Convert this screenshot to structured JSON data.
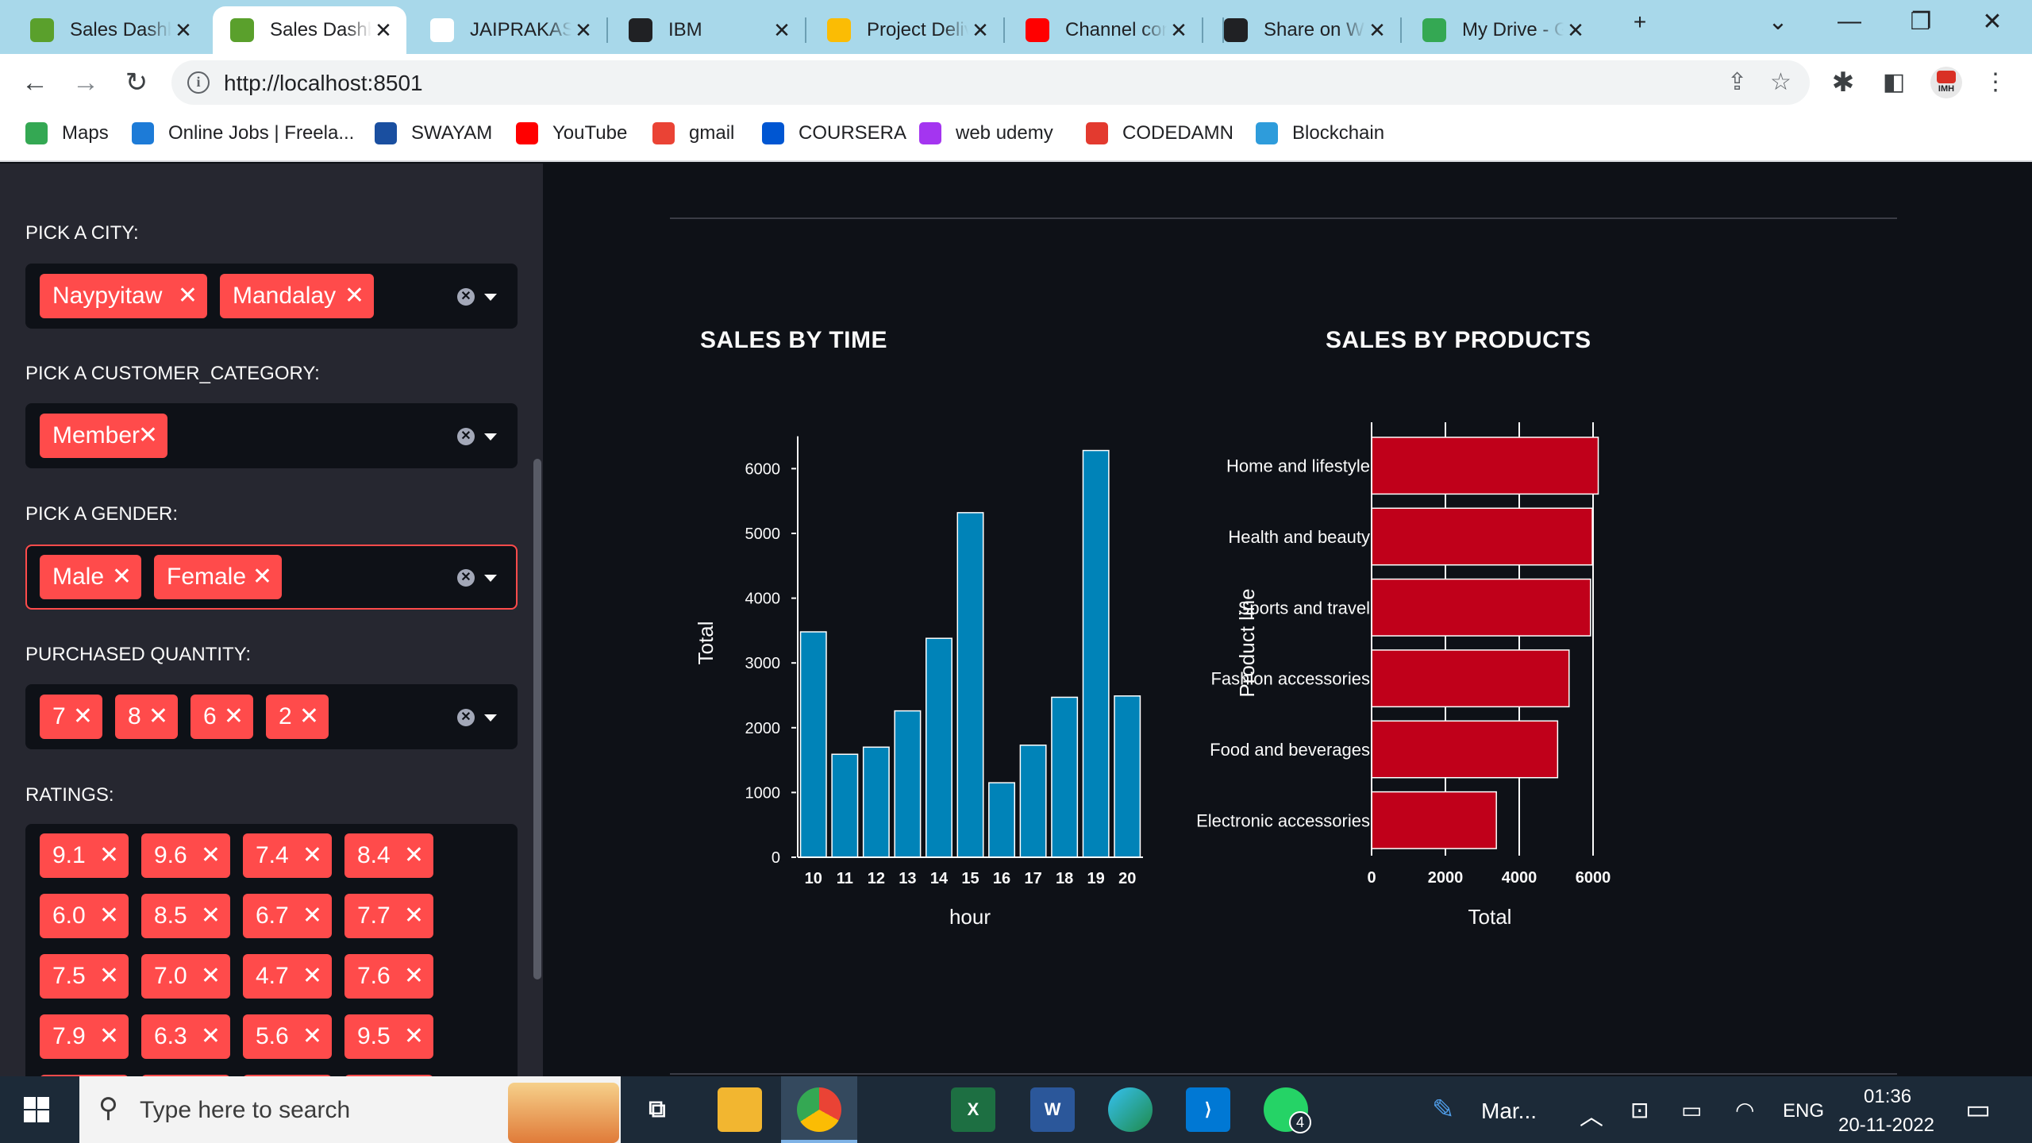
{
  "browser": {
    "tabs": [
      {
        "title": "Sales Dashboard",
        "icon_color": "#5aa02c",
        "active": false
      },
      {
        "title": "Sales Dashboard",
        "icon_color": "#5aa02c",
        "active": true
      },
      {
        "title": "JAIPRAKASH",
        "icon_color": "#ffffff",
        "active": false
      },
      {
        "title": "IBM",
        "icon_color": "#202124",
        "active": false
      },
      {
        "title": "Project Delivery",
        "icon_color": "#fbbc04",
        "active": false
      },
      {
        "title": "Channel content",
        "icon_color": "#ff0000",
        "active": false
      },
      {
        "title": "Share on WhatsApp",
        "icon_color": "#202124",
        "active": false
      },
      {
        "title": "My Drive - Google Drive",
        "icon_color": "#34a853",
        "active": false
      }
    ],
    "new_tab_label": "+",
    "url": "http://localhost:8501",
    "bookmarks": [
      {
        "label": "Maps",
        "icon_color": "#34a853"
      },
      {
        "label": "Online Jobs | Freela...",
        "icon_color": "#1d7bd7"
      },
      {
        "label": "SWAYAM",
        "icon_color": "#1a4fa0"
      },
      {
        "label": "YouTube",
        "icon_color": "#ff0000"
      },
      {
        "label": "gmail",
        "icon_color": "#ea4335"
      },
      {
        "label": "COURSERA",
        "icon_color": "#0056d2"
      },
      {
        "label": "web udemy",
        "icon_color": "#a435f0"
      },
      {
        "label": "CODEDAMN",
        "icon_color": "#e33a2f"
      },
      {
        "label": "Blockchain",
        "icon_color": "#2e9cdb"
      }
    ],
    "profile_label": "IMH"
  },
  "sidebar": {
    "city": {
      "label": "PICK A CITY:",
      "chips": [
        "Naypyitaw",
        "Mandalay"
      ]
    },
    "customer": {
      "label": "PICK A CUSTOMER_CATEGORY:",
      "chips": [
        "Member"
      ]
    },
    "gender": {
      "label": "PICK A GENDER:",
      "chips": [
        "Male",
        "Female"
      ]
    },
    "quantity": {
      "label": "PURCHASED QUANTITY:",
      "chips": [
        "7",
        "8",
        "6",
        "2"
      ]
    },
    "ratings": {
      "label": "RATINGS:",
      "chips": [
        "9.1",
        "9.6",
        "7.4",
        "8.4",
        "6.0",
        "8.5",
        "6.7",
        "7.7",
        "7.5",
        "7.0",
        "4.7",
        "7.6",
        "7.9",
        "6.3",
        "5.6",
        "9.5"
      ]
    },
    "chip_close": "✕",
    "clear_glyph": "✕"
  },
  "main": {
    "time_title": "SALES BY TIME",
    "products_title": "SALES BY PRODUCTS"
  },
  "chart_data": [
    {
      "type": "bar",
      "title": "SALES BY TIME",
      "xlabel": "hour",
      "ylabel": "Total",
      "categories": [
        "10",
        "11",
        "12",
        "13",
        "14",
        "15",
        "16",
        "17",
        "18",
        "19",
        "20"
      ],
      "values": [
        3480,
        1590,
        1700,
        2260,
        3380,
        5320,
        1150,
        1730,
        2470,
        6280,
        2490
      ],
      "ylim": [
        0,
        6500
      ],
      "yticks": [
        0,
        1000,
        2000,
        3000,
        4000,
        5000,
        6000
      ],
      "color": "#0083b8",
      "grid": false
    },
    {
      "type": "bar",
      "orientation": "horizontal",
      "title": "SALES BY PRODUCTS",
      "xlabel": "Total",
      "ylabel": "Product line",
      "categories": [
        "Home and lifestyle",
        "Health and beauty",
        "Sports and travel",
        "Fashion accessories",
        "Food and beverages",
        "Electronic accessories"
      ],
      "values": [
        6140,
        5980,
        5930,
        5350,
        5040,
        3380
      ],
      "xlim": [
        0,
        6300
      ],
      "xticks": [
        0,
        2000,
        4000,
        6000
      ],
      "color": "#c0001a",
      "grid": true
    }
  ],
  "taskbar": {
    "search_placeholder": "Type here to search",
    "marker_label": "Mar...",
    "language": "ENG",
    "time": "01:36",
    "date": "20-11-2022",
    "whatsapp_badge": "4"
  }
}
